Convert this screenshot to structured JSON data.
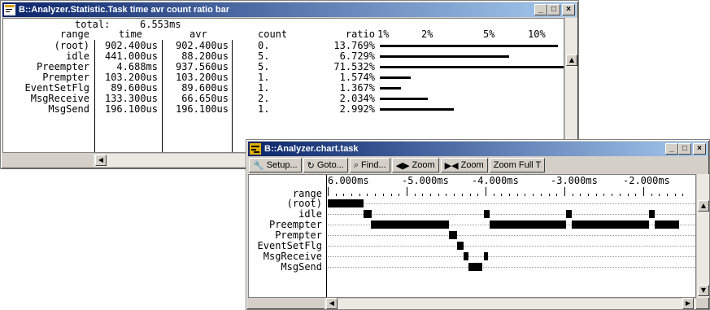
{
  "statistic_window": {
    "title": "B::Analyzer.Statistic.Task time avr count ratio bar",
    "total_label": "total:",
    "total_value": "6.553ms",
    "headers": {
      "range": "range",
      "time": "time",
      "avr": "avr",
      "count": "count",
      "ratio": "ratio"
    },
    "ratio_scale": [
      "1%",
      "2%",
      "5%",
      "10%"
    ],
    "rows": [
      {
        "range": "(root)",
        "time": "902.400us",
        "avr": "902.400us",
        "count": "0.",
        "ratio": "13.769%",
        "ratio_value": 13.769
      },
      {
        "range": "idle",
        "time": "441.000us",
        "avr": "88.200us",
        "count": "5.",
        "ratio": "6.729%",
        "ratio_value": 6.729
      },
      {
        "range": "Preempter",
        "time": "4.688ms",
        "avr": "937.560us",
        "count": "5.",
        "ratio": "71.532%",
        "ratio_value": 71.532
      },
      {
        "range": "Prempter",
        "time": "103.200us",
        "avr": "103.200us",
        "count": "1.",
        "ratio": "1.574%",
        "ratio_value": 1.574
      },
      {
        "range": "EventSetFlg",
        "time": "89.600us",
        "avr": "89.600us",
        "count": "1.",
        "ratio": "1.367%",
        "ratio_value": 1.367
      },
      {
        "range": "MsgReceive",
        "time": "133.300us",
        "avr": "66.650us",
        "count": "2.",
        "ratio": "2.034%",
        "ratio_value": 2.034
      },
      {
        "range": "MsgSend",
        "time": "196.100us",
        "avr": "196.100us",
        "count": "1.",
        "ratio": "2.992%",
        "ratio_value": 2.992
      }
    ]
  },
  "chart_window": {
    "title": "B::Analyzer.chart.task",
    "toolbar": {
      "setup": "Setup...",
      "goto": "Goto...",
      "find": "Find...",
      "zoom_in": "Zoom",
      "zoom_out": "Zoom",
      "zoom_full": "Zoom Full T"
    },
    "range_header": "range",
    "time_axis": [
      "6.000ms",
      "-5.000ms",
      "-4.000ms",
      "-3.000ms",
      "-2.000ms"
    ],
    "time_axis_ms": [
      -6,
      -5,
      -4,
      -3,
      -2
    ],
    "tracks": [
      {
        "label": "(root)",
        "segments": [
          [
            -6.0,
            -5.55
          ]
        ]
      },
      {
        "label": "idle",
        "segments": [
          [
            -5.55,
            -5.45
          ],
          [
            -4.02,
            -3.95
          ],
          [
            -2.98,
            -2.91
          ],
          [
            -1.93,
            -1.86
          ]
        ]
      },
      {
        "label": "Preempter",
        "segments": [
          [
            -5.45,
            -4.46
          ],
          [
            -3.95,
            -2.98
          ],
          [
            -2.91,
            -1.93
          ],
          [
            -1.86,
            -1.55
          ]
        ]
      },
      {
        "label": "Prempter",
        "segments": [
          [
            -4.46,
            -4.36
          ]
        ]
      },
      {
        "label": "EventSetFlg",
        "segments": [
          [
            -4.36,
            -4.28
          ]
        ]
      },
      {
        "label": "MsgReceive",
        "segments": [
          [
            -4.28,
            -4.22
          ],
          [
            -4.02,
            -3.97
          ]
        ]
      },
      {
        "label": "MsgSend",
        "segments": [
          [
            -4.22,
            -4.04
          ]
        ]
      }
    ]
  }
}
